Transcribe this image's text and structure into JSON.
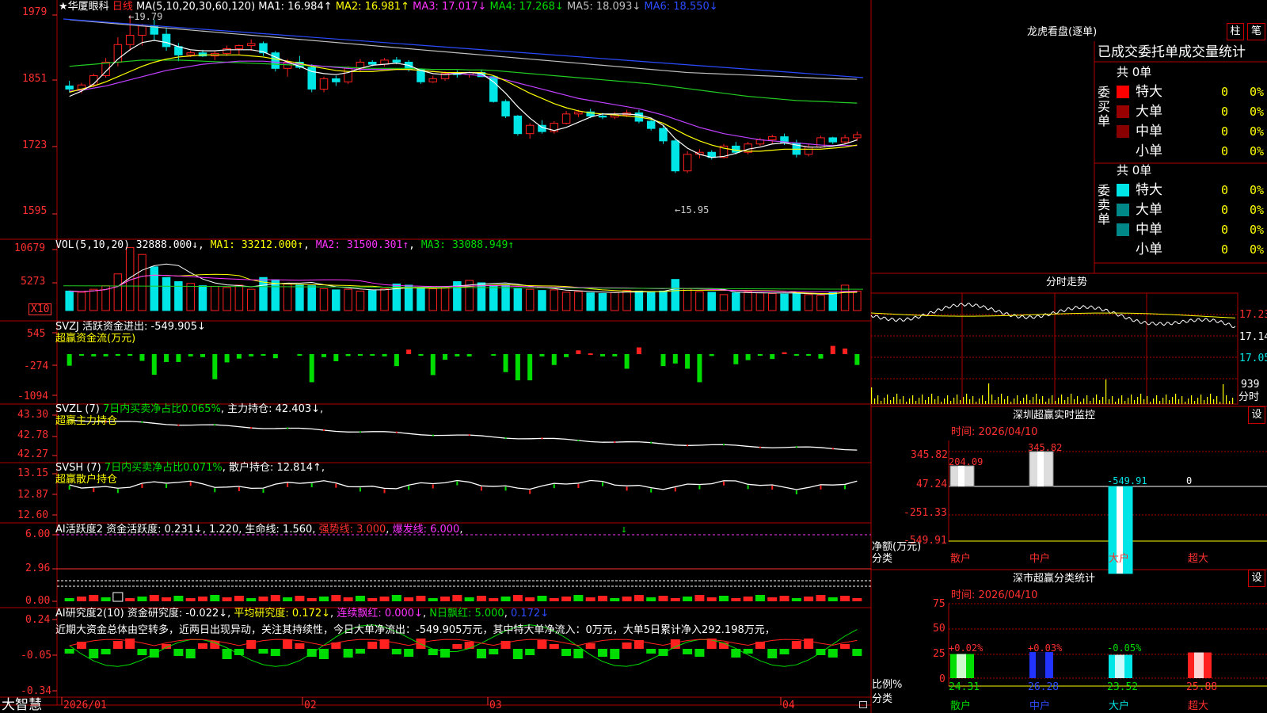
{
  "colors": {
    "up": "#ff2020",
    "down": "#00e5e5",
    "green": "#00dd00",
    "frame": "#b00000",
    "yellow": "#ffff00",
    "magenta": "#ff33ff",
    "purple": "#c040ff",
    "blue": "#2b4cff",
    "gray": "#c0c0c0",
    "greenline": "#22cc22"
  },
  "stock": {
    "star": "★",
    "name": "华厦眼科",
    "period": "日线"
  },
  "k_panel": {
    "ma_title": "MA(5,10,20,30,60,120)",
    "ma1": "MA1: 16.984↑",
    "ma2": "MA2: 16.981↑",
    "ma3": "MA3: 17.017↓",
    "ma4": "MA4: 17.268↓",
    "ma5": "MA5: 18.093↓",
    "ma6": "MA6: 18.550↓",
    "y_labels": [
      "1979",
      "1851",
      "1723",
      "1595"
    ],
    "high_note": "←19.79",
    "low_note": "←15.95"
  },
  "vol_panel": {
    "title": "VOL(5,10,20)",
    "v": "32888.000↓",
    "ma1": "MA1: 33212.000↑",
    "ma2": "MA2: 31500.301↑",
    "ma3": "MA3: 33088.949↑",
    "y_labels": [
      "10679",
      "5273"
    ],
    "unit": "X10"
  },
  "svzj": {
    "title": "SVZJ  活跃资金进出: -549.905↓",
    "sub": "超赢资金流(万元)",
    "y_labels": [
      "545",
      "-274",
      "-1094"
    ]
  },
  "svzl": {
    "name": "SVZL (7)",
    "stat": "7日内买卖净占比0.065%",
    "hold": "主力持仓: 42.403↓",
    "sub": "超赢主力持仓",
    "y_labels": [
      "43.30",
      "42.78",
      "42.27"
    ]
  },
  "svsh": {
    "name": "SVSH (7)",
    "stat": "7日内买卖净占比0.071%",
    "hold": "散户持仓: 12.814↑",
    "sub": "超赢散户持仓",
    "y_labels": [
      "13.15",
      "12.87",
      "12.60"
    ]
  },
  "ai1": {
    "name": "AI活跃度2",
    "v1": "资金活跃度: 0.231↓",
    "v2": "1.220",
    "v3": "生命线: 1.560",
    "v4": "强势线: 3.000",
    "v5": "爆发线: 6.000",
    "mark": "↓",
    "y_labels": [
      "6.00",
      "2.96",
      "0.00"
    ]
  },
  "ai2": {
    "name": "AI研究度2(10)",
    "v1": "资金研究度: -0.022↓",
    "v2": "平均研究度: 0.172↓",
    "v3": "连续飘红: 0.000↓",
    "v4": "N日飘红: 5.000",
    "v5": "0.172↓",
    "comment": "近期大资金总体由空转多，近两日出现异动，关注其持续性，今日大单净流出：-549.905万元，其中特大单净流入：0万元，大单5日累计净入292.198万元，",
    "y_labels": [
      "0.24",
      "-0.05",
      "-0.34"
    ]
  },
  "date_axis": {
    "labels": [
      "2026/01",
      "02",
      "03",
      "04"
    ]
  },
  "brand": "大智慧",
  "longhu": {
    "title": "龙虎看盘(逐单)",
    "btn_zhu": "柱",
    "btn_bi": "笔",
    "header": "已成交委托单成交量统计",
    "buy": {
      "label": "委买单",
      "count": "共 0单",
      "rows": [
        {
          "name": "特大",
          "v": "0",
          "p": "0%"
        },
        {
          "name": "大单",
          "v": "0",
          "p": "0%"
        },
        {
          "name": "中单",
          "v": "0",
          "p": "0%"
        },
        {
          "name": "小单",
          "v": "0",
          "p": "0%"
        }
      ]
    },
    "sell": {
      "label": "委卖单",
      "count": "共 0单",
      "rows": [
        {
          "name": "特大",
          "v": "0",
          "p": "0%"
        },
        {
          "name": "大单",
          "v": "0",
          "p": "0%"
        },
        {
          "name": "中单",
          "v": "0",
          "p": "0%"
        },
        {
          "name": "小单",
          "v": "0",
          "p": "0%"
        }
      ]
    }
  },
  "intraday": {
    "title": "分时走势",
    "y_labels": [
      "17.23",
      "17.14",
      "17.05"
    ],
    "vol_label": "939",
    "time_label": "分时"
  },
  "sz_monitor": {
    "title": "深圳超赢实时监控",
    "btn": "设",
    "time": "时间: 2026/04/10",
    "y_labels": [
      "345.82",
      "47.24",
      "-251.33",
      "-549.91"
    ],
    "values": [
      204.09,
      345.82,
      -549.91,
      0
    ],
    "value_labels": [
      "204.09",
      "345.82",
      "-549.91",
      "0"
    ],
    "categories": [
      "散户",
      "中户",
      "大户",
      "超大"
    ],
    "ylabel": "净额(万元)",
    "xlabel": "分类"
  },
  "sz_class": {
    "title": "深市超赢分类统计",
    "btn": "设",
    "time": "时间: 2026/04/10",
    "y_labels": [
      "75",
      "50",
      "25",
      "0"
    ],
    "values": [
      24.31,
      26.28,
      23.52,
      25.88
    ],
    "value_labels": [
      "24.31",
      "26.28",
      "23.52",
      "25.88"
    ],
    "pct_labels": [
      "+0.02%",
      "+0.03%",
      "-0.05%",
      ""
    ],
    "categories": [
      "散户",
      "中户",
      "大户",
      "超大"
    ],
    "ylabel": "比例%",
    "xlabel": "分类"
  },
  "chart_data": [
    {
      "type": "candlestick",
      "title": "华厦眼科 日线",
      "y_ticks": [
        19.79,
        18.51,
        17.23,
        15.95
      ],
      "high": 19.79,
      "low": 15.95,
      "ma": {
        "MA1": 16.984,
        "MA2": 16.981,
        "MA3": 17.017,
        "MA4": 17.268,
        "MA5": 18.093,
        "MA6": 18.55
      },
      "ohlc": [
        [
          18.42,
          18.52,
          18.3,
          18.36
        ],
        [
          18.36,
          18.48,
          18.28,
          18.44
        ],
        [
          18.44,
          18.66,
          18.4,
          18.62
        ],
        [
          18.62,
          18.96,
          18.58,
          18.88
        ],
        [
          18.88,
          19.36,
          18.8,
          19.22
        ],
        [
          19.22,
          19.79,
          19.1,
          19.4
        ],
        [
          19.4,
          19.62,
          19.2,
          19.58
        ],
        [
          19.58,
          19.7,
          19.3,
          19.42
        ],
        [
          19.42,
          19.55,
          19.1,
          19.18
        ],
        [
          19.18,
          19.25,
          18.9,
          19.02
        ],
        [
          19.02,
          19.1,
          18.98,
          19.06
        ],
        [
          19.06,
          19.12,
          18.98,
          19.0
        ],
        [
          19.0,
          19.1,
          18.92,
          19.05
        ],
        [
          19.05,
          19.2,
          19.0,
          19.14
        ],
        [
          19.14,
          19.22,
          19.02,
          19.2
        ],
        [
          19.2,
          19.32,
          19.1,
          19.24
        ],
        [
          19.24,
          19.28,
          19.0,
          19.06
        ],
        [
          19.06,
          19.1,
          18.7,
          18.76
        ],
        [
          18.76,
          18.94,
          18.6,
          18.88
        ],
        [
          18.88,
          19.0,
          18.75,
          18.78
        ],
        [
          18.78,
          18.84,
          18.3,
          18.36
        ],
        [
          18.36,
          18.6,
          18.3,
          18.56
        ],
        [
          18.56,
          18.62,
          18.42,
          18.5
        ],
        [
          18.5,
          18.8,
          18.46,
          18.76
        ],
        [
          18.76,
          18.94,
          18.7,
          18.88
        ],
        [
          18.88,
          18.92,
          18.8,
          18.84
        ],
        [
          18.84,
          18.96,
          18.8,
          18.92
        ],
        [
          18.92,
          18.98,
          18.84,
          18.88
        ],
        [
          18.88,
          18.92,
          18.7,
          18.74
        ],
        [
          18.74,
          18.76,
          18.46,
          18.5
        ],
        [
          18.5,
          18.62,
          18.48,
          18.56
        ],
        [
          18.56,
          18.7,
          18.52,
          18.66
        ],
        [
          18.66,
          18.72,
          18.58,
          18.64
        ],
        [
          18.64,
          18.7,
          18.58,
          18.68
        ],
        [
          18.68,
          18.74,
          18.62,
          18.6
        ],
        [
          18.6,
          18.62,
          18.1,
          18.12
        ],
        [
          18.12,
          18.16,
          17.8,
          17.84
        ],
        [
          17.84,
          17.86,
          17.46,
          17.5
        ],
        [
          17.5,
          17.7,
          17.4,
          17.66
        ],
        [
          17.66,
          17.76,
          17.5,
          17.54
        ],
        [
          17.54,
          17.74,
          17.5,
          17.7
        ],
        [
          17.7,
          17.94,
          17.68,
          17.88
        ],
        [
          17.88,
          17.96,
          17.82,
          17.92
        ],
        [
          17.92,
          17.98,
          17.8,
          17.84
        ],
        [
          17.84,
          17.9,
          17.78,
          17.82
        ],
        [
          17.82,
          17.92,
          17.78,
          17.86
        ],
        [
          17.86,
          17.96,
          17.82,
          17.9
        ],
        [
          17.9,
          17.96,
          17.7,
          17.74
        ],
        [
          17.74,
          17.78,
          17.56,
          17.6
        ],
        [
          17.6,
          17.66,
          17.3,
          17.36
        ],
        [
          17.36,
          17.4,
          16.74,
          16.78
        ],
        [
          16.78,
          17.16,
          16.74,
          17.1
        ],
        [
          17.1,
          17.2,
          17.02,
          17.14
        ],
        [
          17.14,
          17.18,
          17.0,
          17.04
        ],
        [
          17.04,
          17.3,
          17.02,
          17.26
        ],
        [
          17.26,
          17.34,
          17.1,
          17.14
        ],
        [
          17.14,
          17.34,
          17.1,
          17.3
        ],
        [
          17.3,
          17.42,
          17.26,
          17.38
        ],
        [
          17.38,
          17.48,
          17.3,
          17.44
        ],
        [
          17.44,
          17.5,
          17.28,
          17.32
        ],
        [
          17.32,
          17.38,
          17.04,
          17.1
        ],
        [
          17.1,
          17.3,
          17.06,
          17.24
        ],
        [
          17.24,
          17.46,
          17.22,
          17.42
        ],
        [
          17.42,
          17.44,
          17.3,
          17.34
        ],
        [
          17.34,
          17.48,
          17.3,
          17.42
        ],
        [
          17.42,
          17.54,
          17.36,
          17.48
        ]
      ],
      "ma_lines": {
        "MA1": [
          18.22,
          18.32,
          18.46,
          18.7,
          18.94,
          19.12,
          19.26,
          19.3,
          19.26,
          19.18,
          19.12,
          19.1,
          19.1,
          19.12,
          19.12,
          19.12,
          19.08,
          18.98,
          18.88,
          18.8,
          18.7,
          18.66,
          18.64,
          18.68,
          18.76,
          18.82,
          18.84,
          18.86,
          18.82,
          18.72,
          18.66,
          18.64,
          18.66,
          18.68,
          18.66,
          18.5,
          18.28,
          18.02,
          17.8,
          17.62,
          17.56,
          17.62,
          17.72,
          17.82,
          17.88,
          17.88,
          17.88,
          17.86,
          17.8,
          17.66,
          17.4,
          17.22,
          17.1,
          17.04,
          17.06,
          17.12,
          17.2,
          17.24,
          17.3,
          17.32,
          17.28,
          17.24,
          17.24,
          17.26,
          17.3,
          17.38
        ],
        "MA3": [
          18.3,
          18.36,
          18.42,
          18.5,
          18.6,
          18.7,
          18.8,
          18.88,
          18.94,
          18.98,
          19.0,
          19.02,
          19.02,
          19.02,
          19.02,
          19.0,
          18.98,
          18.94,
          18.9,
          18.86,
          18.8,
          18.76,
          18.72,
          18.7,
          18.7,
          18.7,
          18.72,
          18.74,
          18.74,
          18.72,
          18.7,
          18.68,
          18.68,
          18.68,
          18.68,
          18.62,
          18.52,
          18.4,
          18.28,
          18.18,
          18.08,
          18.0,
          17.94,
          17.9,
          17.88,
          17.86,
          17.84,
          17.82,
          17.78,
          17.7,
          17.58,
          17.46,
          17.36,
          17.28,
          17.22,
          17.18,
          17.16,
          17.16,
          17.18,
          17.2,
          17.2,
          17.2,
          17.2,
          17.22,
          17.24,
          17.28
        ],
        "MA4": [
          18.32,
          18.34,
          18.38,
          18.42,
          18.48,
          18.54,
          18.6,
          18.66,
          18.72,
          18.76,
          18.8,
          18.84,
          18.86,
          18.88,
          18.9,
          18.9,
          18.9,
          18.88,
          18.86,
          18.84,
          18.82,
          18.8,
          18.78,
          18.76,
          18.74,
          18.74,
          18.74,
          18.74,
          18.74,
          18.72,
          18.7,
          18.68,
          18.66,
          18.64,
          18.62,
          18.58,
          18.54,
          18.48,
          18.42,
          18.36,
          18.3,
          18.24,
          18.18,
          18.14,
          18.1,
          18.06,
          18.02,
          17.98,
          17.92,
          17.86,
          17.78,
          17.7,
          17.62,
          17.56,
          17.5,
          17.46,
          17.42,
          17.38,
          17.36,
          17.34,
          17.32,
          17.3,
          17.28,
          17.27,
          17.27,
          17.27
        ],
        "MA5": [
          18.8,
          18.82,
          18.84,
          18.86,
          18.88,
          18.9,
          18.92,
          18.92,
          18.92,
          18.92,
          18.91,
          18.9,
          18.89,
          18.88,
          18.87,
          18.86,
          18.85,
          18.84,
          18.83,
          18.82,
          18.81,
          18.8,
          18.79,
          18.78,
          18.77,
          18.76,
          18.76,
          18.76,
          18.76,
          18.75,
          18.74,
          18.74,
          18.74,
          18.73,
          18.73,
          18.72,
          18.7,
          18.68,
          18.66,
          18.64,
          18.62,
          18.6,
          18.58,
          18.56,
          18.54,
          18.52,
          18.5,
          18.48,
          18.46,
          18.43,
          18.4,
          18.37,
          18.34,
          18.31,
          18.28,
          18.25,
          18.22,
          18.2,
          18.18,
          18.16,
          18.14,
          18.13,
          18.12,
          18.11,
          18.1,
          18.09
        ],
        "MA6": [
          19.7,
          19.68,
          19.66,
          19.64,
          19.62,
          19.6,
          19.58,
          19.56,
          19.54,
          19.52,
          19.5,
          19.48,
          19.46,
          19.44,
          19.42,
          19.4,
          19.38,
          19.36,
          19.34,
          19.32,
          19.3,
          19.28,
          19.26,
          19.24,
          19.22,
          19.2,
          19.18,
          19.16,
          19.14,
          19.12,
          19.1,
          19.08,
          19.06,
          19.04,
          19.02,
          19.0,
          18.98,
          18.96,
          18.94,
          18.92,
          18.9,
          18.88,
          18.86,
          18.84,
          18.82,
          18.8,
          18.78,
          18.76,
          18.74,
          18.72,
          18.7,
          18.68,
          18.67,
          18.66,
          18.65,
          18.64,
          18.63,
          18.62,
          18.61,
          18.6,
          18.59,
          18.58,
          18.57,
          18.56,
          18.555,
          18.55
        ]
      }
    },
    {
      "type": "bar",
      "title": "VOL(5,10,20)",
      "y_ticks": [
        10679,
        5273
      ],
      "values": [
        3300,
        3100,
        3600,
        4200,
        6200,
        10679,
        9500,
        7400,
        5600,
        4900,
        4600,
        4200,
        4100,
        3900,
        4300,
        3600,
        5600,
        5200,
        4500,
        4300,
        4200,
        3700,
        3500,
        3600,
        3300,
        3400,
        3700,
        4500,
        4300,
        3900,
        3700,
        4000,
        4900,
        5100,
        4700,
        4300,
        4400,
        3700,
        3600,
        3400,
        3500,
        3100,
        3200,
        3000,
        2900,
        3100,
        3400,
        3300,
        3200,
        3300,
        5273,
        3700,
        3200,
        3100,
        2700,
        3000,
        3200,
        3000,
        2900,
        2800,
        2900,
        2700,
        2600,
        3100,
        4300,
        3300
      ]
    },
    {
      "type": "bar",
      "title": "SVZJ",
      "y_ticks": [
        545,
        -274,
        -1094
      ],
      "values": [
        -310,
        -40,
        -60,
        -60,
        -20,
        -20,
        -180,
        -550,
        -210,
        -210,
        -60,
        -80,
        -670,
        -220,
        -120,
        -60,
        -40,
        -110,
        0,
        -30,
        -750,
        -80,
        -190,
        -50,
        -40,
        -20,
        -60,
        -320,
        120,
        -40,
        -560,
        -150,
        -60,
        -60,
        0,
        -10,
        -480,
        -700,
        -700,
        -60,
        -290,
        -80,
        100,
        20,
        -60,
        -60,
        -390,
        180,
        0,
        -320,
        -250,
        -390,
        -750,
        -50,
        0,
        -270,
        -160,
        -40,
        -130,
        50,
        -40,
        -20,
        -120,
        220,
        150,
        -290
      ]
    },
    {
      "type": "line",
      "title": "SVZL",
      "y_ticks": [
        43.3,
        42.78,
        42.27
      ]
    },
    {
      "type": "line",
      "title": "SVSH",
      "y_ticks": [
        13.15,
        12.87,
        12.6
      ]
    },
    {
      "type": "bar",
      "title": "AI活跃度2",
      "y_ticks": [
        6.0,
        2.96,
        0.0
      ]
    },
    {
      "type": "bar",
      "title": "AI研究度2(10)",
      "y_ticks": [
        0.24,
        -0.05,
        -0.34
      ]
    },
    {
      "type": "bar",
      "title": "深圳超赢实时监控",
      "categories": [
        "散户",
        "中户",
        "大户",
        "超大"
      ],
      "values": [
        204.09,
        345.82,
        -549.91,
        0
      ]
    },
    {
      "type": "bar",
      "title": "深市超赢分类统计",
      "categories": [
        "散户",
        "中户",
        "大户",
        "超大"
      ],
      "values": [
        24.31,
        26.28,
        23.52,
        25.88
      ]
    }
  ]
}
